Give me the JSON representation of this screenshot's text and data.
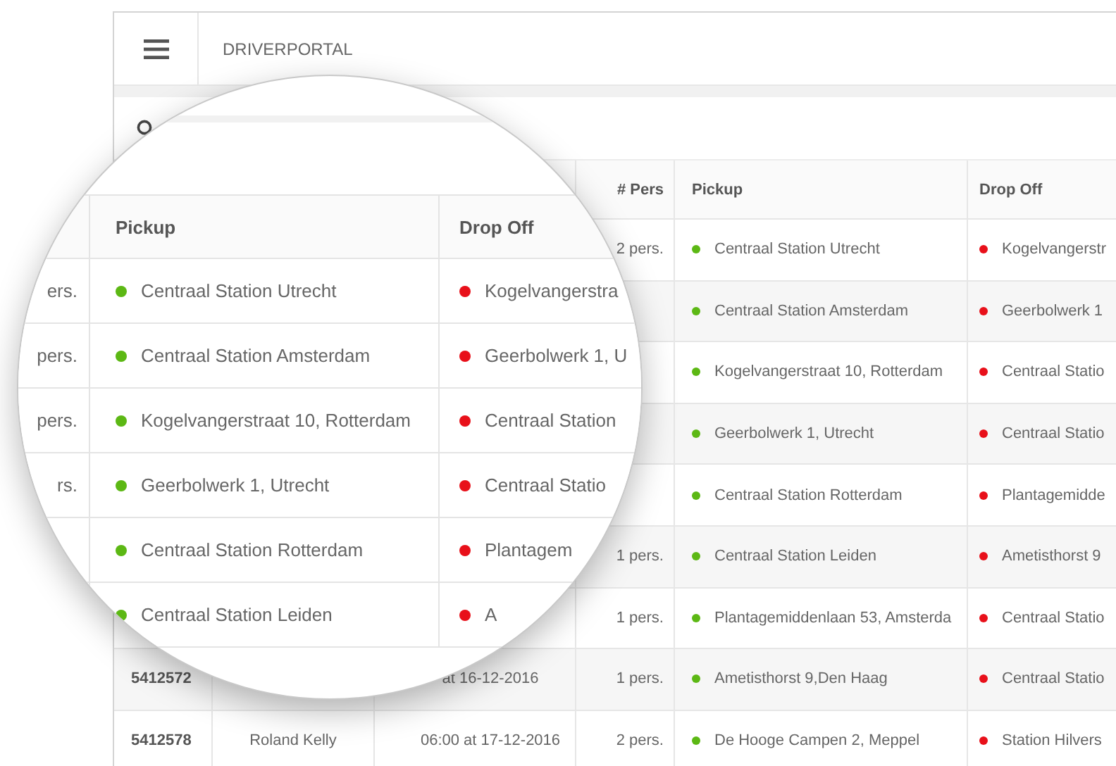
{
  "app": {
    "title": "DRIVERPORTAL"
  },
  "table": {
    "columns": [
      "# Pers",
      "Pickup",
      "Drop Off"
    ],
    "rows": [
      {
        "persons": "2 pers.",
        "pickup": "Centraal Station Utrecht",
        "dropoff": "Kogelvangerstr"
      },
      {
        "pickup": "Centraal Station Amsterdam",
        "dropoff": "Geerbolwerk 1"
      },
      {
        "pickup": "Kogelvangerstraat 10, Rotterdam",
        "dropoff": "Centraal Statio"
      },
      {
        "pickup": "Geerbolwerk 1, Utrecht",
        "dropoff": "Centraal Statio"
      },
      {
        "pickup": "Centraal Station Rotterdam",
        "dropoff": "Plantagemidde"
      },
      {
        "persons": "1 pers.",
        "pickup": "Centraal Station Leiden",
        "dropoff": "Ametisthorst 9"
      },
      {
        "persons": "1 pers.",
        "pickup": "Plantagemiddenlaan 53, Amsterda",
        "dropoff": "Centraal Statio"
      },
      {
        "id": "5412572",
        "time": "at 16-12-2016",
        "persons": "1 pers.",
        "pickup": "Ametisthorst 9,Den Haag",
        "dropoff": "Centraal Statio"
      },
      {
        "id": "5412578",
        "driver": "Roland Kelly",
        "time": "06:00 at 17-12-2016",
        "persons": "2 pers.",
        "pickup": "De Hooge Campen 2, Meppel",
        "dropoff": "Station Hilvers"
      }
    ]
  },
  "magnifier": {
    "columns": [
      "Pickup",
      "Drop Off"
    ],
    "rows": [
      {
        "persons": "ers.",
        "pickup": "Centraal Station Utrecht",
        "dropoff": "Kogelvangerstra"
      },
      {
        "persons": "pers.",
        "pickup": "Centraal Station Amsterdam",
        "dropoff": "Geerbolwerk 1, U"
      },
      {
        "persons": "pers.",
        "pickup": "Kogelvangerstraat 10, Rotterdam",
        "dropoff": "Centraal Station"
      },
      {
        "persons": "rs.",
        "pickup": "Geerbolwerk 1, Utrecht",
        "dropoff": "Centraal Statio"
      },
      {
        "pickup": "Centraal Station Rotterdam",
        "dropoff": "Plantagem"
      },
      {
        "pickup": "Centraal Station Leiden",
        "dropoff": "A"
      }
    ]
  }
}
